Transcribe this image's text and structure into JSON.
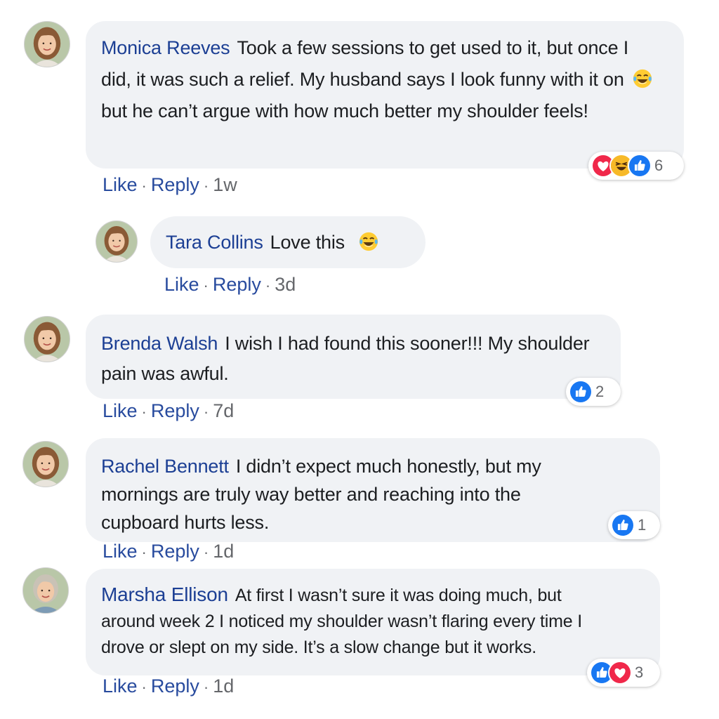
{
  "comments": [
    {
      "author": "Monica Reeves",
      "text_before": "Took a few sessions to get used to it, but once I did, it was such a relief. My husband says I look funny with it on",
      "emoji": "laughing-crying-emoji",
      "text_after": "but he can’t argue with how much better my shoulder feels!",
      "reaction_icons": [
        "love-icon",
        "laugh-icon",
        "like-icon"
      ],
      "reaction_count": "6",
      "like": "Like",
      "reply": "Reply",
      "time": "1w"
    },
    {
      "author": "Tara Collins",
      "text_before": "Love this",
      "emoji": "laughing-crying-emoji",
      "like": "Like",
      "reply": "Reply",
      "time": "3d"
    },
    {
      "author": "Brenda Walsh",
      "text": "I wish I had found this sooner!!! My shoulder pain was awful.",
      "reaction_icons": [
        "like-icon"
      ],
      "reaction_count": "2",
      "like": "Like",
      "reply": "Reply",
      "time": "7d"
    },
    {
      "author": "Rachel Bennett",
      "text": "I didn’t expect much honestly, but my mornings are truly way better and reaching into the cupboard hurts less.",
      "reaction_icons": [
        "like-icon"
      ],
      "reaction_count": "1",
      "like": "Like",
      "reply": "Reply",
      "time": "1d"
    },
    {
      "author": "Marsha Ellison",
      "text": "At first I wasn’t sure it was doing much, but around week 2 I noticed my shoulder wasn’t flaring every time I drove or slept on my side. It’s a slow change but it works.",
      "reaction_icons": [
        "like-icon",
        "love-icon"
      ],
      "reaction_count": "3",
      "like": "Like",
      "reply": "Reply",
      "time": "1d"
    }
  ],
  "separator": "·",
  "colors": {
    "bubble": "#f0f2f5",
    "author": "#1c3f94",
    "link": "#284b9e",
    "like_blue": "#1877f2",
    "love_red": "#f0284a",
    "laugh_yellow": "#f7b928"
  }
}
